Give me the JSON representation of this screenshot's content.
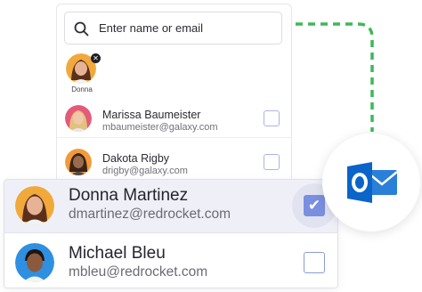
{
  "search": {
    "placeholder": "Enter name or email"
  },
  "selected_chip": {
    "label": "Donna"
  },
  "list": [
    {
      "name": "Marissa Baumeister",
      "email": "mbaumeister@galaxy.com",
      "checked": false
    },
    {
      "name": "Dakota Rigby",
      "email": "drigby@galaxy.com",
      "checked": false
    }
  ],
  "card": [
    {
      "name": "Donna Martinez",
      "email": "dmartinez@redrocket.com",
      "checked": true
    },
    {
      "name": "Michael Bleu",
      "email": "mbleu@redrocket.com",
      "checked": false
    }
  ],
  "icons": {
    "search": "search-icon",
    "remove": "close-icon",
    "check": "checkmark-icon",
    "integration": "outlook-icon"
  },
  "colors": {
    "accent": "#7b8fe0",
    "connector": "#3cb95a",
    "outlook_blue": "#0a64c9"
  }
}
